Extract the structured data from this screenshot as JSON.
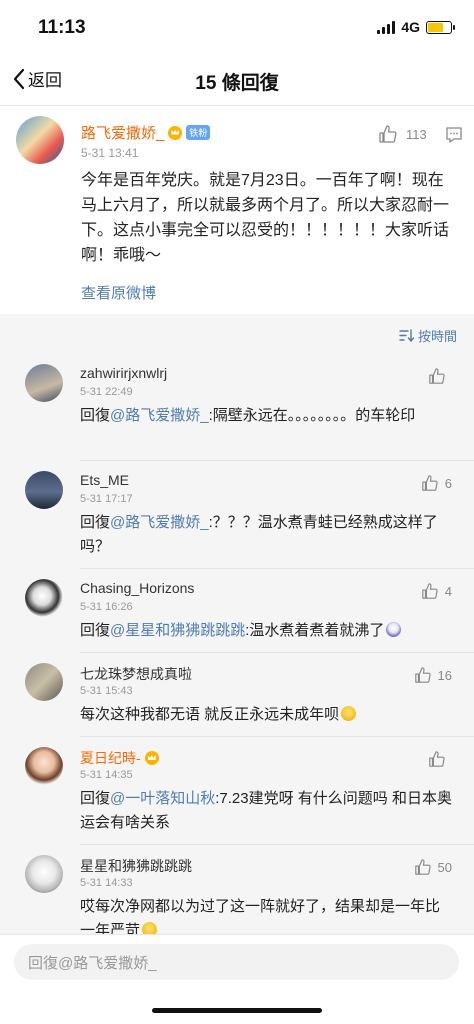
{
  "status": {
    "time": "11:13",
    "network": "4G"
  },
  "nav": {
    "back_label": "返回",
    "title": "15 條回復"
  },
  "post": {
    "author": "路飞爱撒娇_",
    "badge": "铁粉",
    "time": "5-31 13:41",
    "likes": "113",
    "text": "今年是百年党庆。就是7月23日。一百年了啊！现在马上六月了，所以就最多两个月了。所以大家忍耐一下。这点小事完全可以忍受的！！！！！！大家听话啊！乖哦～",
    "view_original": "查看原微博"
  },
  "sort_label": "按時間",
  "comments": [
    {
      "name": "zahwirirjxnwlrj",
      "time": "5-31 22:49",
      "likes": "",
      "reply_prefix": "回復",
      "mention": "@路飞爱撒娇_",
      "text": ":隔壁永远在。。。。。。。。的车轮印"
    },
    {
      "name": "Ets_ME",
      "time": "5-31 17:17",
      "likes": "6",
      "reply_prefix": "回復",
      "mention": "@路飞爱撒娇_",
      "text": ":？？？温水煮青蛙已经熟成这样了吗？"
    },
    {
      "name": "Chasing_Horizons",
      "time": "5-31 16:26",
      "likes": "4",
      "reply_prefix": "回復",
      "mention": "@星星和狒狒跳跳跳",
      "text": ":温水煮着煮着就沸了"
    },
    {
      "name": "七龙珠梦想成真啦",
      "time": "5-31 15:43",
      "likes": "16",
      "reply_prefix": "",
      "mention": "",
      "text": "每次这种我都无语 就反正永远未成年呗"
    },
    {
      "name": "夏日纪時-",
      "time": "5-31 14:35",
      "likes": "",
      "reply_prefix": "回復",
      "mention": "@一叶落知山秋",
      "text": ":7.23建党呀 有什么问题吗 和日本奥运会有啥关系"
    },
    {
      "name": "星星和狒狒跳跳跳",
      "time": "5-31 14:33",
      "likes": "50",
      "reply_prefix": "",
      "mention": "",
      "text": "哎每次净网都以为过了这一阵就好了，结果却是一年比一年严苛"
    }
  ],
  "input": {
    "placeholder": "回復@路飞爱撒娇_"
  },
  "colors": {
    "link": "#507daf",
    "vip_name": "#f76b08",
    "background_gray": "#f5f5f5"
  }
}
